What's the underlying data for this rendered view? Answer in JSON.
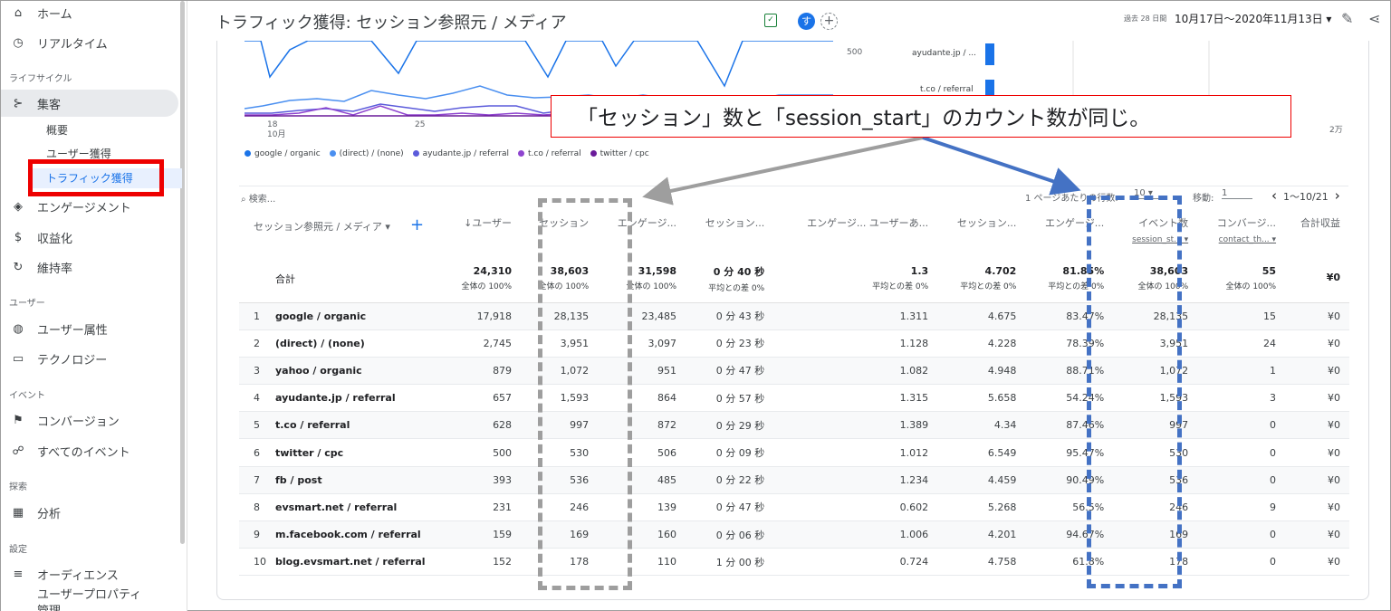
{
  "sidebar": {
    "items": [
      {
        "label": "ホーム",
        "icon": "home-icon"
      },
      {
        "label": "リアルタイム",
        "icon": "clock-icon"
      },
      {
        "label": "集客",
        "icon": "acquisition-icon"
      },
      {
        "label": "エンゲージメント",
        "icon": "tag-icon"
      },
      {
        "label": "収益化",
        "icon": "dollar-icon"
      },
      {
        "label": "維持率",
        "icon": "retention-icon"
      },
      {
        "label": "ユーザー属性",
        "icon": "globe-icon"
      },
      {
        "label": "テクノロジー",
        "icon": "devices-icon"
      },
      {
        "label": "コンバージョン",
        "icon": "flag-icon"
      },
      {
        "label": "すべてのイベント",
        "icon": "events-icon"
      },
      {
        "label": "分析",
        "icon": "analysis-icon"
      },
      {
        "label": "オーディエンス",
        "icon": "audience-icon"
      }
    ],
    "sections": [
      "ライフサイクル",
      "ユーザー",
      "イベント",
      "探索",
      "設定"
    ],
    "subitems": [
      "概要",
      "ユーザー獲得",
      "トラフィック獲得"
    ],
    "cutoff": [
      "ユーザープロパティ",
      "管理"
    ]
  },
  "header": {
    "title": "トラフィック獲得: セッション参照元 / メディア",
    "avatar": "す",
    "add_compare": "+",
    "range_tag": "過去 28 日間",
    "range": "10月17日～2020年11月13日 ▾"
  },
  "chart": {
    "x_ticks": [
      "18",
      "10月",
      "25"
    ],
    "y_tick": "500",
    "right_tick": "2万",
    "bar_labels": [
      "ayudante.jp / ...",
      "t.co / referral"
    ],
    "legend": [
      {
        "label": "google / organic",
        "color": "#1a73e8"
      },
      {
        "label": "(direct) / (none)",
        "color": "#4a8ff0"
      },
      {
        "label": "ayudante.jp / referral",
        "color": "#5b5bdb"
      },
      {
        "label": "t.co / referral",
        "color": "#8e44cf"
      },
      {
        "label": "twitter / cpc",
        "color": "#6a1b9a"
      }
    ]
  },
  "toolbar": {
    "search_placeholder": "検索...",
    "rows_per_page_label": "1 ページあたりの行数:",
    "rows_per_page": "10",
    "goto_label": "移動:",
    "goto_value": "1",
    "pager": "1〜10/21"
  },
  "table": {
    "headers": [
      {
        "label": "セッション参照元 / メディア ▾"
      },
      {
        "label": "↓ユーザー"
      },
      {
        "label": "セッション"
      },
      {
        "label": "エンゲージ..."
      },
      {
        "label": "セッション..."
      },
      {
        "label": "エンゲージ... ユーザーあ..."
      },
      {
        "label": "セッション..."
      },
      {
        "label": "エンゲージ..."
      },
      {
        "label": "イベント数",
        "sub": "session_st... ▾"
      },
      {
        "label": "コンバージ...",
        "sub": "contact_th... ▾"
      },
      {
        "label": "合計収益"
      }
    ],
    "total": {
      "label": "合計",
      "values": [
        "24,310",
        "38,603",
        "31,598",
        "0 分 40 秒",
        "1.3",
        "4.702",
        "81.85%",
        "38,603",
        "55",
        "¥0"
      ],
      "pcts": [
        "全体の 100%",
        "全体の 100%",
        "全体の 100%",
        "平均との差 0%",
        "平均との差 0%",
        "平均との差 0%",
        "平均との差 0%",
        "全体の 100%",
        "全体の 100%",
        ""
      ]
    },
    "rows": [
      {
        "idx": "1",
        "dim": "google / organic",
        "v": [
          "17,918",
          "28,135",
          "23,485",
          "0 分 43 秒",
          "1.311",
          "4.675",
          "83.47%",
          "28,135",
          "15",
          "¥0"
        ]
      },
      {
        "idx": "2",
        "dim": "(direct) / (none)",
        "v": [
          "2,745",
          "3,951",
          "3,097",
          "0 分 23 秒",
          "1.128",
          "4.228",
          "78.39%",
          "3,951",
          "24",
          "¥0"
        ]
      },
      {
        "idx": "3",
        "dim": "yahoo / organic",
        "v": [
          "879",
          "1,072",
          "951",
          "0 分 47 秒",
          "1.082",
          "4.948",
          "88.71%",
          "1,072",
          "1",
          "¥0"
        ]
      },
      {
        "idx": "4",
        "dim": "ayudante.jp / referral",
        "v": [
          "657",
          "1,593",
          "864",
          "0 分 57 秒",
          "1.315",
          "5.658",
          "54.24%",
          "1,593",
          "3",
          "¥0"
        ]
      },
      {
        "idx": "5",
        "dim": "t.co / referral",
        "v": [
          "628",
          "997",
          "872",
          "0 分 29 秒",
          "1.389",
          "4.34",
          "87.46%",
          "997",
          "0",
          "¥0"
        ]
      },
      {
        "idx": "6",
        "dim": "twitter / cpc",
        "v": [
          "500",
          "530",
          "506",
          "0 分 09 秒",
          "1.012",
          "6.549",
          "95.47%",
          "530",
          "0",
          "¥0"
        ]
      },
      {
        "idx": "7",
        "dim": "fb / post",
        "v": [
          "393",
          "536",
          "485",
          "0 分 22 秒",
          "1.234",
          "4.459",
          "90.49%",
          "536",
          "0",
          "¥0"
        ]
      },
      {
        "idx": "8",
        "dim": "evsmart.net / referral",
        "v": [
          "231",
          "246",
          "139",
          "0 分 47 秒",
          "0.602",
          "5.268",
          "56.5%",
          "246",
          "9",
          "¥0"
        ]
      },
      {
        "idx": "9",
        "dim": "m.facebook.com / referral",
        "v": [
          "159",
          "169",
          "160",
          "0 分 06 秒",
          "1.006",
          "4.201",
          "94.67%",
          "169",
          "0",
          "¥0"
        ]
      },
      {
        "idx": "10",
        "dim": "blog.evsmart.net / referral",
        "v": [
          "152",
          "178",
          "110",
          "1 分 00 秒",
          "0.724",
          "4.758",
          "61.8%",
          "178",
          "0",
          "¥0"
        ]
      }
    ]
  },
  "annotation": {
    "callout": "「セッション」数と「session_start」のカウント数が同じ。",
    "colors": {
      "red": "#ee0000",
      "gray": "#9e9e9e",
      "blue": "#4472c4"
    }
  }
}
